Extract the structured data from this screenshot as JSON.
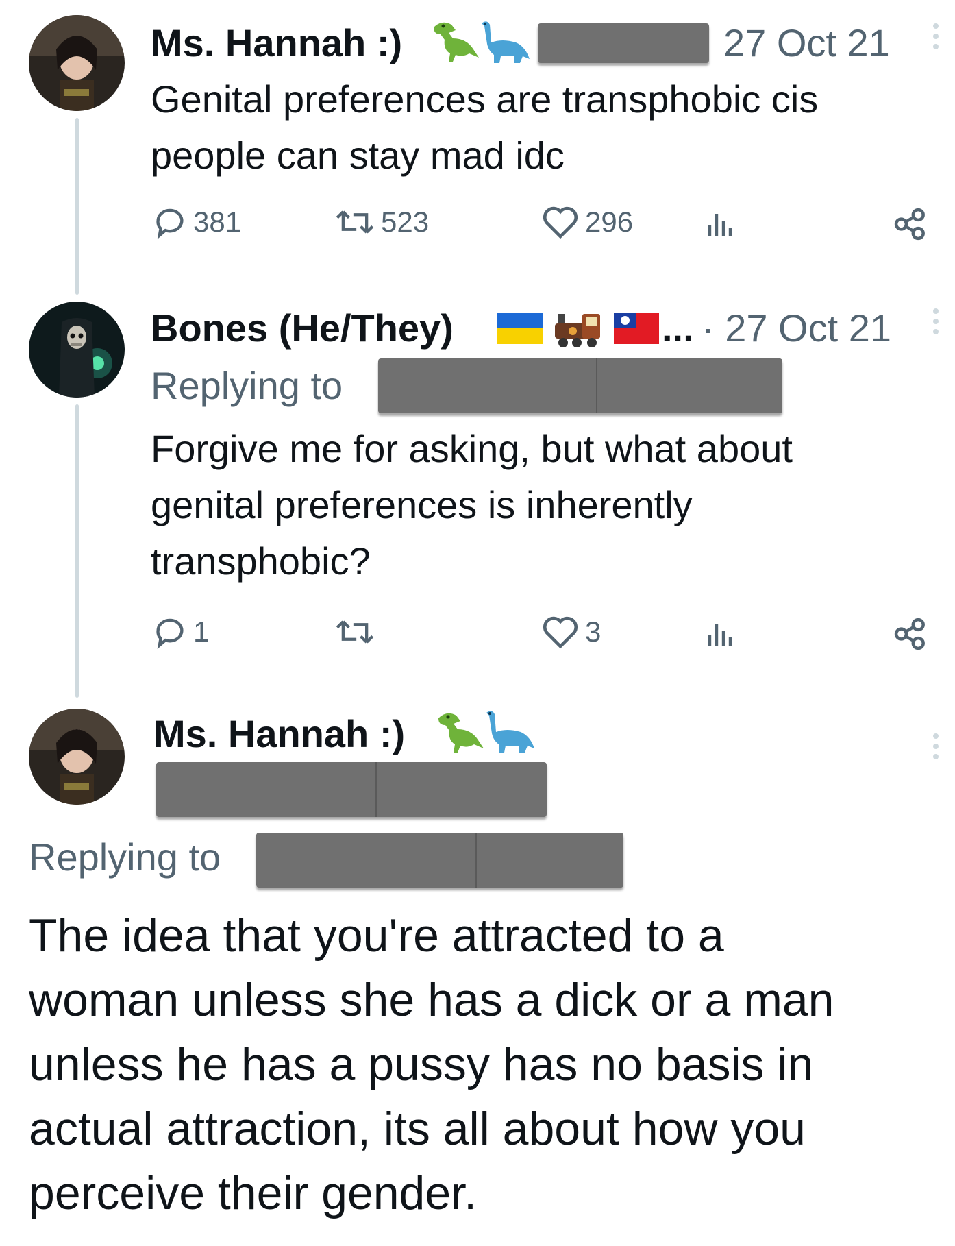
{
  "thread": {
    "tweet1": {
      "author_name": "Ms. Hannah :)",
      "emoji": [
        "dinosaur-trex-icon",
        "dinosaur-sauropod-icon"
      ],
      "date": "27 Oct 21",
      "text_lines": [
        "Genital preferences are transphobic cis",
        "people can stay mad idc"
      ],
      "stats": {
        "replies": "381",
        "retweets": "523",
        "likes": "296"
      }
    },
    "tweet2": {
      "author_name": "Bones (He/They)",
      "emoji": [
        "ukraine-flag-icon",
        "locomotive-icon",
        "taiwan-flag-icon"
      ],
      "ellipsis": "...",
      "date": "· 27 Oct 21",
      "replying_to_label": "Replying to",
      "text_lines": [
        "Forgive me for asking, but what about",
        "genital preferences is inherently",
        "transphobic?"
      ],
      "stats": {
        "replies": "1",
        "retweets": "",
        "likes": "3"
      }
    },
    "tweet3": {
      "author_name": "Ms. Hannah :)",
      "emoji": [
        "dinosaur-trex-icon",
        "dinosaur-sauropod-icon"
      ],
      "replying_to_label": "Replying to",
      "text_lines": [
        "The idea that you're attracted to a",
        "woman unless she has a dick or a man",
        "unless he has a pussy has no basis in",
        "actual attraction, its all about how you",
        "perceive their gender."
      ]
    }
  },
  "colors": {
    "text": "#0f1419",
    "muted": "#536471",
    "thread_line": "#cfd9de",
    "redaction": "#707070"
  }
}
